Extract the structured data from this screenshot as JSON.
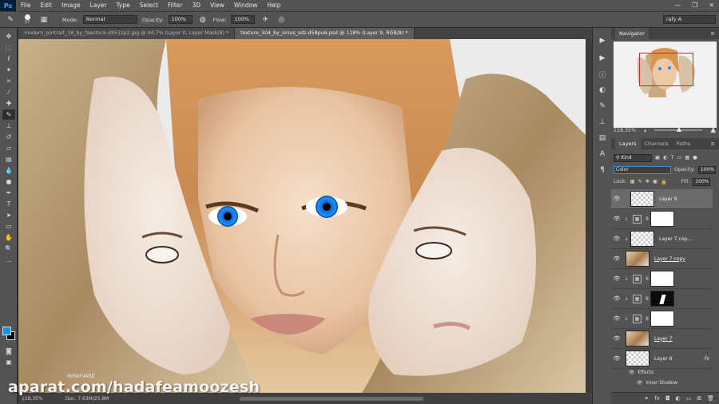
{
  "app": {
    "logo": "Ps"
  },
  "menu": [
    "File",
    "Edit",
    "Image",
    "Layer",
    "Type",
    "Select",
    "Filter",
    "3D",
    "View",
    "Window",
    "Help"
  ],
  "window_controls": {
    "minimize": "—",
    "maximize": "❐",
    "close": "✕"
  },
  "options_bar": {
    "brush_size": "37",
    "mode_label": "Mode:",
    "mode_value": "Normal",
    "opacity_label": "Opacity:",
    "opacity_value": "100%",
    "flow_label": "Flow:",
    "flow_value": "100%",
    "workspace": "rafy A"
  },
  "tabs": [
    {
      "label": "modern_portrait_18_by_faestock-d951zp2.jpg @ 44,7% (Layer 0, Layer Mask/8) *",
      "active": false
    },
    {
      "label": "texture_304_by_sirius_sdz-d58pu6.psd @ 118% (Layer 9, RGB/8) *",
      "active": true
    }
  ],
  "status": {
    "zoom": "118,35%",
    "doc": "Doc: 7,63M/25,8M"
  },
  "navigator": {
    "title": "Navigator",
    "zoom": "118,35%"
  },
  "layers_panel": {
    "tabs": [
      "Layers",
      "Channels",
      "Paths"
    ],
    "kind_label": "Kind",
    "blend_mode": "Color",
    "opacity_label": "Opacity:",
    "opacity_value": "100%",
    "lock_label": "Lock:",
    "fill_label": "Fill:",
    "fill_value": "100%",
    "layers": [
      {
        "name": "Layer 9",
        "thumb": "check",
        "selected": true
      },
      {
        "name": "",
        "thumb": "adj",
        "mask": "white"
      },
      {
        "name": "Layer 7 cop...",
        "thumb": "check"
      },
      {
        "name": "Layer 7 copy",
        "thumb": "photo"
      },
      {
        "name": "",
        "thumb": "adj",
        "mask": "white"
      },
      {
        "name": "",
        "thumb": "adj",
        "mask": "black"
      },
      {
        "name": "",
        "thumb": "adj",
        "mask": "white"
      },
      {
        "name": "Layer 7",
        "thumb": "photo"
      },
      {
        "name": "Layer 8",
        "thumb": "check",
        "fx": "fx"
      }
    ],
    "effects_label": "Effects",
    "inner_shadow_label": "Inner Shadow"
  },
  "watermark": {
    "main": "aparat.com/hadafeamoozesh",
    "small": "M/RAFVARE"
  },
  "colors": {
    "ui_bg": "#535353",
    "canvas_bg": "#e9e9e9",
    "accent": "#3d8fe0",
    "iris": "#1e90ff"
  }
}
